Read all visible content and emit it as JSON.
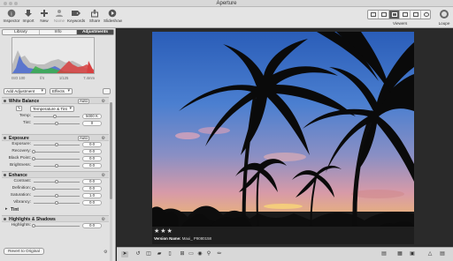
{
  "window": {
    "title": "Aperture"
  },
  "toolbar": {
    "items": [
      {
        "label": "Inspector",
        "icon": "inspector-icon"
      },
      {
        "label": "Import",
        "icon": "import-icon"
      },
      {
        "label": "New",
        "icon": "new-icon"
      },
      {
        "label": "Name",
        "icon": "name-icon"
      },
      {
        "label": "Keywords",
        "icon": "keywords-icon"
      },
      {
        "label": "Share",
        "icon": "share-icon"
      },
      {
        "label": "Slideshow",
        "icon": "slideshow-icon"
      }
    ],
    "viewers_label": "Viewers",
    "loupe_label": "Loupe"
  },
  "inspector": {
    "tabs": [
      "Library",
      "Info",
      "Adjustments"
    ],
    "active_tab": "Adjustments",
    "exif": [
      "ISO 100",
      "f/4",
      "1/125",
      "7.4mm"
    ],
    "add_adjustment": "Add Adjustment",
    "effects": "Effects",
    "white_balance": {
      "title": "White Balance",
      "auto": "Auto",
      "mode": "Temperature & Tint",
      "rows": [
        {
          "label": "Temp:",
          "value": "5000 K"
        },
        {
          "label": "Tint:",
          "value": "0"
        }
      ]
    },
    "exposure": {
      "title": "Exposure",
      "auto": "Auto",
      "rows": [
        {
          "label": "Exposure:",
          "value": "0.0"
        },
        {
          "label": "Recovery:",
          "value": "0.0"
        },
        {
          "label": "Black Point:",
          "value": "0.0"
        },
        {
          "label": "Brightness:",
          "value": "0.0"
        }
      ]
    },
    "enhance": {
      "title": "Enhance",
      "rows": [
        {
          "label": "Contrast:",
          "value": "0.0"
        },
        {
          "label": "Definition:",
          "value": "0.0"
        },
        {
          "label": "Saturation:",
          "value": "1.0"
        },
        {
          "label": "Vibrancy:",
          "value": "0.0"
        }
      ],
      "tint_label": "Tint"
    },
    "highlights_shadows": {
      "title": "Highlights & Shadows",
      "rows": [
        {
          "label": "Highlights:",
          "value": "0.0"
        }
      ]
    },
    "revert": "Revert to Original"
  },
  "photo": {
    "rating": "★★★",
    "version_label": "Version Name:",
    "version_value": "Maui_ P9080158"
  }
}
